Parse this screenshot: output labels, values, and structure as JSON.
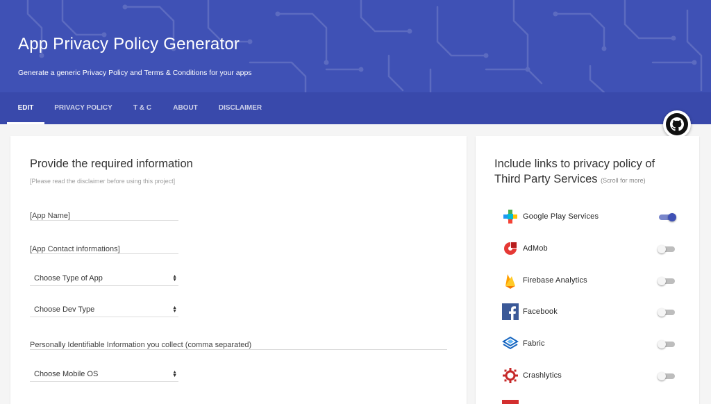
{
  "header": {
    "title": "App Privacy Policy Generator",
    "subtitle": "Generate a generic Privacy Policy and Terms & Conditions for your apps"
  },
  "nav": {
    "tabs": [
      {
        "label": "EDIT",
        "active": true
      },
      {
        "label": "PRIVACY POLICY",
        "active": false
      },
      {
        "label": "T & C",
        "active": false
      },
      {
        "label": "ABOUT",
        "active": false
      },
      {
        "label": "DISCLAIMER",
        "active": false
      }
    ]
  },
  "github": {
    "icon": "github-icon"
  },
  "form": {
    "title": "Provide the required information",
    "note": "[Please read the disclaimer before using this project]",
    "app_name_placeholder": "[App Name]",
    "contact_placeholder": "[App Contact informations]",
    "app_type_select": "Choose Type of App",
    "dev_type_select": "Choose Dev Type",
    "pii_placeholder": "Personally Identifiable Information you collect (comma separated)",
    "mobile_os_select": "Choose Mobile OS"
  },
  "third_party": {
    "title_line1": "Include links to privacy policy of",
    "title_line2": "Third Party Services",
    "scroll_hint": "(Scroll for more)",
    "services": [
      {
        "name": "Google Play Services",
        "icon": "google-play-services-icon",
        "enabled": true
      },
      {
        "name": "AdMob",
        "icon": "admob-icon",
        "enabled": false
      },
      {
        "name": "Firebase Analytics",
        "icon": "firebase-icon",
        "enabled": false
      },
      {
        "name": "Facebook",
        "icon": "facebook-icon",
        "enabled": false
      },
      {
        "name": "Fabric",
        "icon": "fabric-icon",
        "enabled": false
      },
      {
        "name": "Crashlytics",
        "icon": "crashlytics-icon",
        "enabled": false
      }
    ]
  },
  "colors": {
    "primary": "#3f51b5",
    "nav": "#3949ab",
    "accent_track": "#7986cb"
  }
}
